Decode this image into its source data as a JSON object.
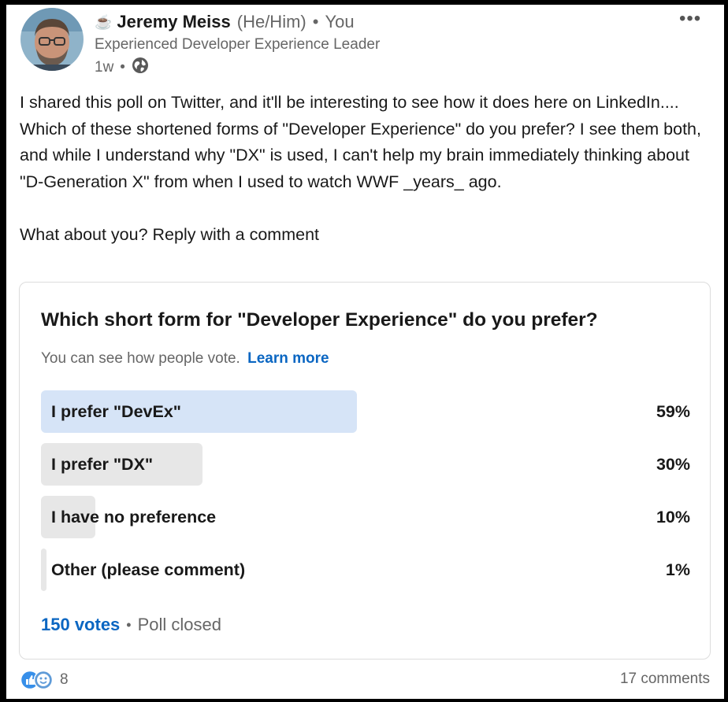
{
  "author": {
    "emoji": "☕",
    "name": "Jeremy Meiss",
    "pronouns": "(He/Him)",
    "relation": "You",
    "headline": "Experienced Developer Experience Leader",
    "time": "1w"
  },
  "post": {
    "paragraph1": "I shared this poll on Twitter, and it'll be interesting to see how it does here on LinkedIn.... Which of these shortened forms of \"Developer Experience\" do you prefer? I see them both, and while I understand why \"DX\" is used, I can't help my brain immediately thinking about \"D-Generation X\" from when I used to watch WWF _years_ ago.",
    "paragraph2": "What about you? Reply with a comment"
  },
  "poll": {
    "question": "Which short form for \"Developer Experience\" do you prefer?",
    "note": "You can see how people vote.",
    "learn_more": "Learn more",
    "options": [
      {
        "label": "I prefer \"DevEx\"",
        "percent_text": "59%",
        "percent": 59,
        "selected": true
      },
      {
        "label": "I prefer \"DX\"",
        "percent_text": "30%",
        "percent": 30,
        "selected": false
      },
      {
        "label": "I have no preference",
        "percent_text": "10%",
        "percent": 10,
        "selected": false
      },
      {
        "label": "Other (please comment)",
        "percent_text": "1%",
        "percent": 1,
        "selected": false
      }
    ],
    "votes": "150 votes",
    "status": "Poll closed"
  },
  "social": {
    "reaction_icons": [
      "like-icon",
      "smile-icon"
    ],
    "reaction_count": "8",
    "comments": "17 comments"
  },
  "colors": {
    "link_blue": "#0a66c2",
    "selected_bar": "#d6e4f7",
    "bar_gray": "#e7e7e7"
  }
}
